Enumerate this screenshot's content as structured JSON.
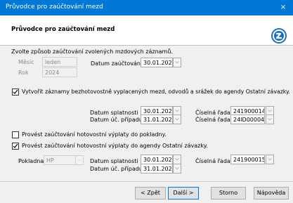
{
  "window": {
    "title": "Průvodce pro zaúčtování mezd",
    "close_icon": "×"
  },
  "header": {
    "title": "Průvodce pro zaúčtování mezd",
    "logo_icon": "arrow-logo-icon",
    "accent": "#1a6fc4"
  },
  "intro": "Zvolte způsob zaúčtování zvolených mzdových záznamů.",
  "period": {
    "month_label": "Měsíc",
    "month_value": "leden",
    "year_label": "Rok",
    "year_value": "2024",
    "posting_date_label": "Datum zaúčtování",
    "posting_date_value": "30.01.2024"
  },
  "option1": {
    "checked": true,
    "label": "Vytvořit záznamy bezhotovostně vyplacených mezd, odvodů a srážek do agendy Ostatní závazky.",
    "due_date_label": "Datum splatnosti",
    "due_date_value": "30.01.2024",
    "case_date_label": "Datum úč. případu",
    "case_date_value": "31.01.2024",
    "series1_label": "Číselná řada",
    "series1_value": "241900014",
    "series2_label": "Číselná řada",
    "series2_value": "24ID00004"
  },
  "option2": {
    "checked": false,
    "label": "Provést zaúčtování hotovostní výplaty do pokladny."
  },
  "option3": {
    "checked": true,
    "label": "Provést zaúčtování hotovostní výplaty do agendy Ostatní závazky.",
    "cashbox_label": "Pokladna",
    "cashbox_value": "HP",
    "due_date_label": "Datum splatnosti",
    "due_date_value": "30.01.2024",
    "case_date_label": "Datum úč. případu",
    "case_date_value": "31.01.2024",
    "series_label": "Číselná řada",
    "series_value": "241900015"
  },
  "buttons": {
    "back": "< Zpět",
    "next": "Další >",
    "cancel": "Storno",
    "help": "Nápověda"
  }
}
